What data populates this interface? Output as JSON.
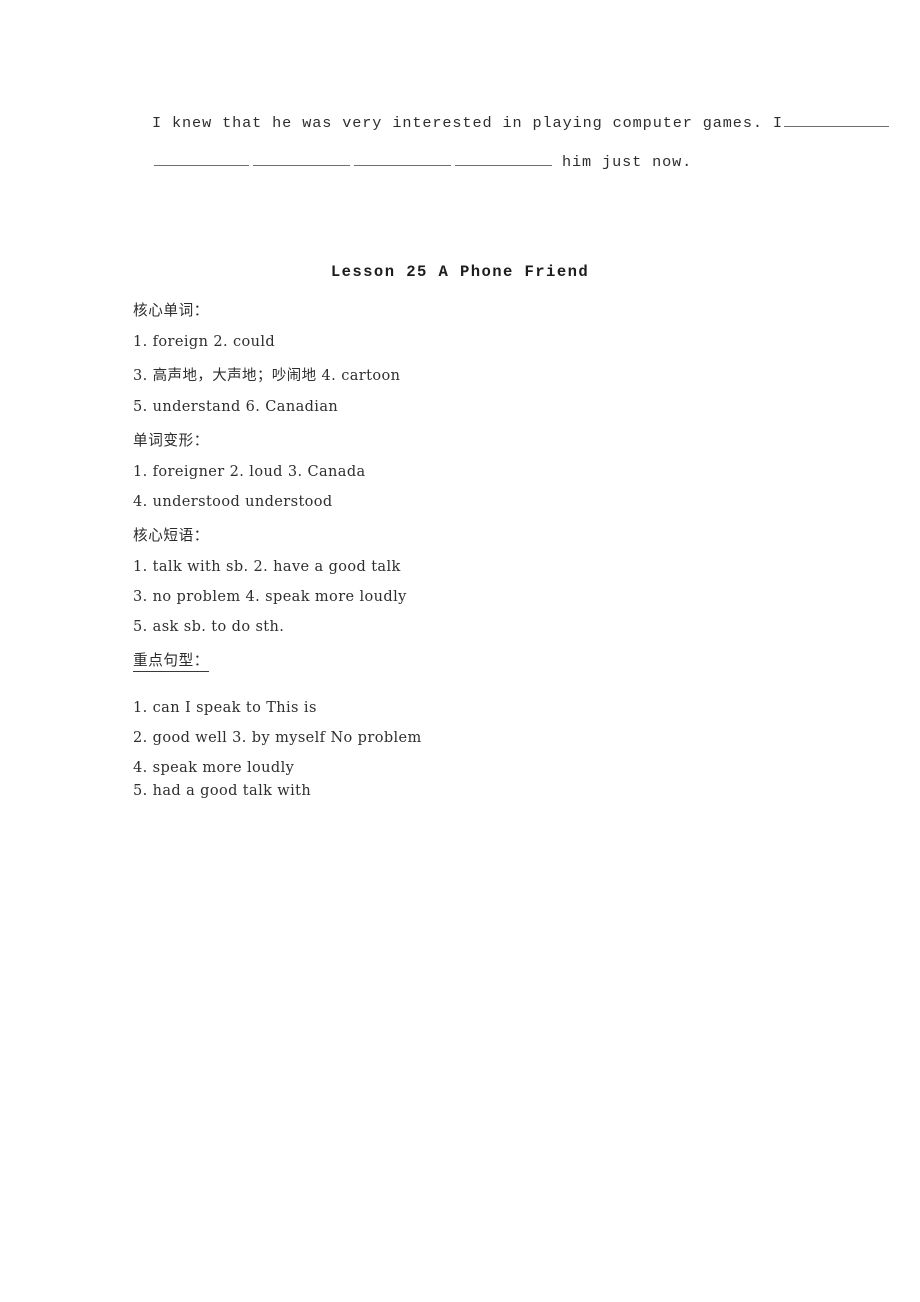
{
  "document": {
    "exercise": {
      "line1_text": "I knew that he was very interested in playing computer games.  I",
      "line2_tail": "him just now.",
      "blank_count_line2": 4
    },
    "lesson_title": "Lesson 25  A Phone Friend",
    "sections": [
      {
        "heading": "核心单词：",
        "underlined": false,
        "items": [
          {
            "text": "1. foreign  2. could",
            "cjk": false,
            "tight": false
          },
          {
            "text": "3. 高声地，大声地；吵闹地  4. cartoon",
            "cjk": true,
            "tight": false
          },
          {
            "text": "5. understand  6. Canadian",
            "cjk": false,
            "tight": false
          }
        ]
      },
      {
        "heading": "单词变形：",
        "underlined": false,
        "items": [
          {
            "text": "1. foreigner  2. loud  3. Canada",
            "cjk": false,
            "tight": false
          },
          {
            "text": "4. understood  understood",
            "cjk": false,
            "tight": false
          }
        ]
      },
      {
        "heading": "核心短语：",
        "underlined": false,
        "items": [
          {
            "text": "1. talk with sb.   2. have a good talk",
            "cjk": false,
            "tight": false
          },
          {
            "text": "3. no problem  4. speak more loudly",
            "cjk": false,
            "tight": false
          },
          {
            "text": "5. ask sb. to do sth.",
            "cjk": false,
            "tight": false
          }
        ]
      },
      {
        "heading": "重点句型：",
        "underlined": true,
        "items": [
          {
            "text": "1. can  I  speak  to  This  is",
            "cjk": false,
            "tight": false
          },
          {
            "text": "2. good  well  3. by  myself  No  problem",
            "cjk": false,
            "tight": false
          },
          {
            "text": "4. speak  more  loudly",
            "cjk": false,
            "tight": true
          },
          {
            "text": "5. had  a  good  talk  with",
            "cjk": false,
            "tight": true
          }
        ]
      }
    ]
  }
}
